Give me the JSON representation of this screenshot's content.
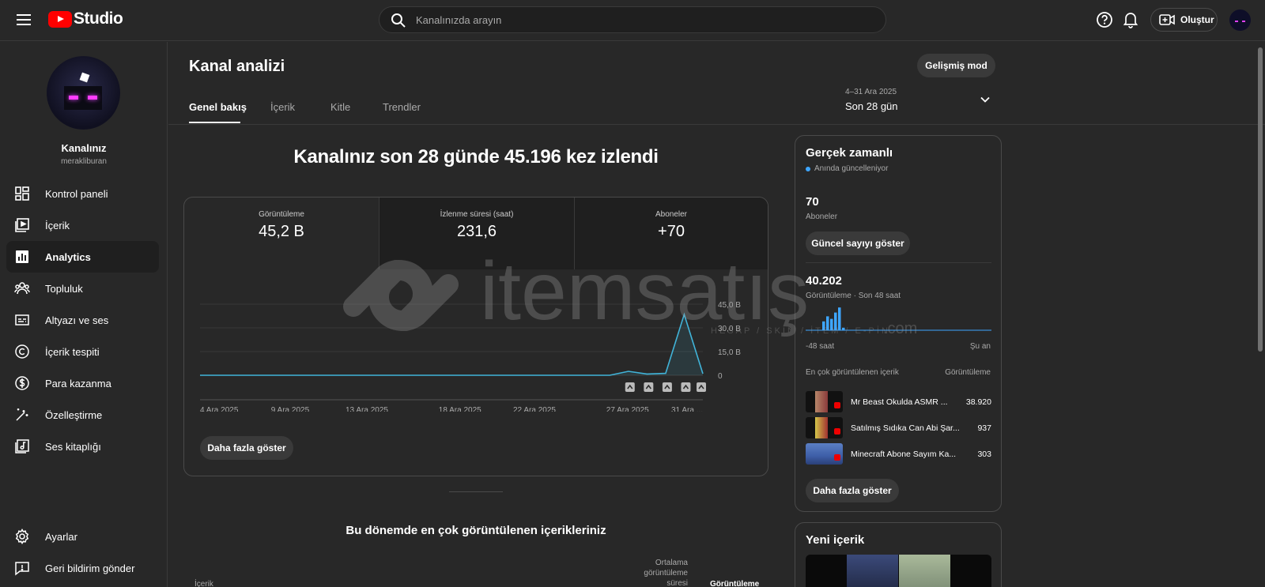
{
  "app": {
    "logo_text": "Studio",
    "brand_red": "#ff0000",
    "accent": "#3ea6ff"
  },
  "search": {
    "placeholder": "Kanalınızda arayın"
  },
  "topbar": {
    "create_label": "Oluştur"
  },
  "channel": {
    "name": "Kanalınız",
    "handle": "merakliburan"
  },
  "sidebar": {
    "items": [
      {
        "label": "Kontrol paneli",
        "icon": "dashboard-icon"
      },
      {
        "label": "İçerik",
        "icon": "content-icon"
      },
      {
        "label": "Analytics",
        "icon": "analytics-icon",
        "active": true
      },
      {
        "label": "Topluluk",
        "icon": "community-icon"
      },
      {
        "label": "Altyazı ve ses",
        "icon": "subtitles-icon"
      },
      {
        "label": "İçerik tespiti",
        "icon": "copyright-icon"
      },
      {
        "label": "Para kazanma",
        "icon": "dollar-icon"
      },
      {
        "label": "Özelleştirme",
        "icon": "magic-wand-icon"
      },
      {
        "label": "Ses kitaplığı",
        "icon": "audio-library-icon"
      }
    ],
    "bottom": [
      {
        "label": "Ayarlar",
        "icon": "gear-icon"
      },
      {
        "label": "Geri bildirim gönder",
        "icon": "feedback-icon"
      }
    ]
  },
  "page": {
    "title": "Kanal analizi",
    "advanced_label": "Gelişmiş mod",
    "tabs": [
      "Genel bakış",
      "İçerik",
      "Kitle",
      "Trendler"
    ],
    "date_range": {
      "dates": "4–31 Ara 2025",
      "label": "Son 28 gün"
    }
  },
  "overview": {
    "headline": "Kanalınız son 28 günde 45.196 kez izlendi",
    "metrics": [
      {
        "label": "Görüntüleme",
        "value": "45,2 B"
      },
      {
        "label": "İzlenme süresi (saat)",
        "value": "231,6"
      },
      {
        "label": "Aboneler",
        "value": "+70"
      }
    ],
    "more_label": "Daha fazla göster"
  },
  "chart_data": {
    "type": "area",
    "title": "",
    "xlabel": "",
    "ylabel": "",
    "x_tick_labels": [
      "4 Ara 2025",
      "9 Ara 2025",
      "13 Ara 2025",
      "18 Ara 2025",
      "22 Ara 2025",
      "27 Ara 2025",
      "31 Ara ..."
    ],
    "y_tick_labels": [
      "45,0 B",
      "30,0 B",
      "15,0 B",
      "0"
    ],
    "ylim": [
      0,
      45000
    ],
    "x": [
      "4 Ara",
      "5 Ara",
      "6 Ara",
      "7 Ara",
      "8 Ara",
      "9 Ara",
      "10 Ara",
      "11 Ara",
      "12 Ara",
      "13 Ara",
      "14 Ara",
      "15 Ara",
      "16 Ara",
      "17 Ara",
      "18 Ara",
      "19 Ara",
      "20 Ara",
      "21 Ara",
      "22 Ara",
      "23 Ara",
      "24 Ara",
      "25 Ara",
      "26 Ara",
      "27 Ara",
      "28 Ara",
      "29 Ara",
      "30 Ara",
      "31 Ara"
    ],
    "series": [
      {
        "values": [
          0,
          0,
          0,
          0,
          0,
          0,
          0,
          0,
          0,
          0,
          0,
          0,
          0,
          0,
          0,
          0,
          0,
          0,
          0,
          0,
          0,
          0,
          0,
          2500,
          800,
          1200,
          38500,
          1000
        ]
      }
    ],
    "color": "#41b4d9",
    "grid": true
  },
  "top_content": {
    "title": "Bu dönemde en çok görüntülenen içerikleriniz",
    "col_content": "İçerik",
    "col_avg": "Ortalama görüntüleme süresi",
    "col_views": "Görüntüleme"
  },
  "realtime": {
    "title": "Gerçek zamanlı",
    "live_label": "Anında güncelleniyor",
    "subscribers": "70",
    "subscribers_label": "Aboneler",
    "show_count_label": "Güncel sayıyı göster",
    "views": "40.202",
    "views_label": "Görüntüleme · Son 48 saat",
    "axis_start": "-48 saat",
    "axis_end": "Şu an",
    "bars": [
      0.35,
      0.55,
      0.45,
      0.7,
      0.9,
      0.1
    ],
    "list_header": "En çok görüntülenen içerik",
    "list_header_value": "Görüntüleme",
    "items": [
      {
        "title": "Mr Beast Okulda ASMR ...",
        "views": "38.920"
      },
      {
        "title": "Satılmış Sıdıka Can Abi Şar...",
        "views": "937"
      },
      {
        "title": "Minecraft Abone Sayım Ka...",
        "views": "303"
      }
    ],
    "more_label": "Daha fazla göster"
  },
  "new_content": {
    "title": "Yeni içerik"
  },
  "watermark": {
    "text": "itemsatış",
    "subtext": "HESAP / SKIN / İTEM / E-PİN",
    "domain": ".com"
  }
}
